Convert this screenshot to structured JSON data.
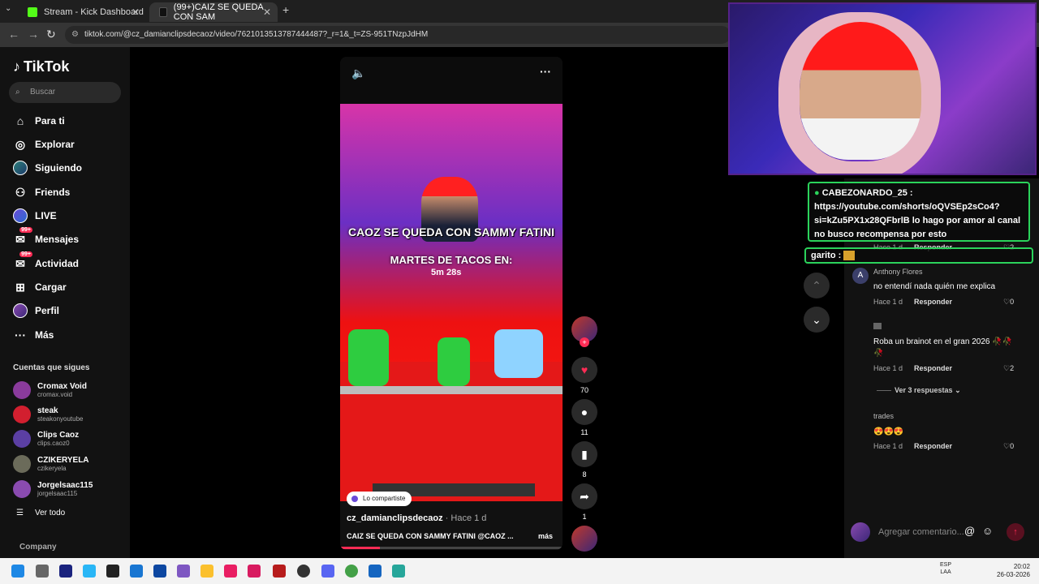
{
  "browser": {
    "tabs": [
      {
        "title": "Stream - Kick Dashboard",
        "close": "✕"
      },
      {
        "title": "(99+)CAIZ SE QUEDA CON SAM",
        "close": "✕"
      }
    ],
    "new_tab": "+",
    "url": "tiktok.com/@cz_damianclipsdecaoz/video/7621013513787444487?_r=1&_t=ZS-951TNzpJdHM"
  },
  "sidebar": {
    "logo": "TikTok",
    "search_placeholder": "Buscar",
    "nav": [
      {
        "label": "Para ti",
        "icon": "home-icon"
      },
      {
        "label": "Explorar",
        "icon": "compass-icon"
      },
      {
        "label": "Siguiendo",
        "icon": "following-avatar-icon"
      },
      {
        "label": "Friends",
        "icon": "friends-icon"
      },
      {
        "label": "LIVE",
        "icon": "live-icon"
      },
      {
        "label": "Mensajes",
        "icon": "messages-icon",
        "badge": "99+"
      },
      {
        "label": "Actividad",
        "icon": "activity-icon",
        "badge": "99+"
      },
      {
        "label": "Cargar",
        "icon": "upload-icon"
      },
      {
        "label": "Perfil",
        "icon": "profile-icon"
      },
      {
        "label": "Más",
        "icon": "more-icon"
      }
    ],
    "following_title": "Cuentas que sigues",
    "following": [
      {
        "name": "Cromax Void",
        "user": "cromax.void",
        "color": "#8a3b9c"
      },
      {
        "name": "steak",
        "user": "steakonyoutube",
        "color": "#d21f2f"
      },
      {
        "name": "Clips Caoz",
        "user": "clips.caoz0",
        "color": "#5b3fa3"
      },
      {
        "name": "CZIKERYELA",
        "user": "czikeryela",
        "color": "#6b6b5a"
      },
      {
        "name": "Jorgelsaac115",
        "user": "jorgelsaac115",
        "color": "#8a4bb0"
      }
    ],
    "see_all": "Ver todo",
    "company": "Company"
  },
  "video": {
    "caption_top": "CAOZ SE QUEDA CON SAMMY FATINI",
    "caption_game": "MARTES DE TACOS EN:",
    "timer": "5m 28s",
    "shared": "Lo compartiste",
    "author": "cz_damianclipsdecaoz",
    "posted": " · Hace 1 d",
    "description": "CAIZ SE QUEDA CON SAMMY FATINI @CAOZ ...",
    "more": "más",
    "progress": 0.18
  },
  "actions": {
    "likes": "70",
    "comments": "11",
    "saves": "8",
    "shares": "1"
  },
  "chat": {
    "message_user": "CABEZONARDO_25 :",
    "message_text": "https://youtube.com/shorts/oQVSEp2sCo4?si=kZu5PX1x28QFbrlB lo hago por amor al canal no busco recompensa por esto",
    "second_user": "garito :"
  },
  "comments": [
    {
      "avatar": "A",
      "name": "Anthony Flores",
      "text": "no entendí nada quién me explica",
      "ago": "Hace 1 d",
      "reply": "Responder",
      "likes": "0"
    },
    {
      "avatar": "",
      "name": "",
      "text": "Roba un brainot en el gran 2026 🥀🥀🥀",
      "ago": "Hace 1 d",
      "reply": "Responder",
      "likes": "2"
    },
    {
      "avatar": "",
      "name": "trades",
      "text": "😍😍😍",
      "ago": "Hace 1 d",
      "reply": "Responder",
      "likes": "0"
    }
  ],
  "hidden_row": {
    "ago": "Hace 1 d",
    "reply": "Responder",
    "likes": "2"
  },
  "view_replies": "Ver 3 respuestas",
  "add_comment_placeholder": "Agregar comentario...",
  "taskbar": {
    "lang_top": "ESP",
    "lang_bottom": "LAA",
    "time": "20:02",
    "date": "26-03-2026"
  }
}
